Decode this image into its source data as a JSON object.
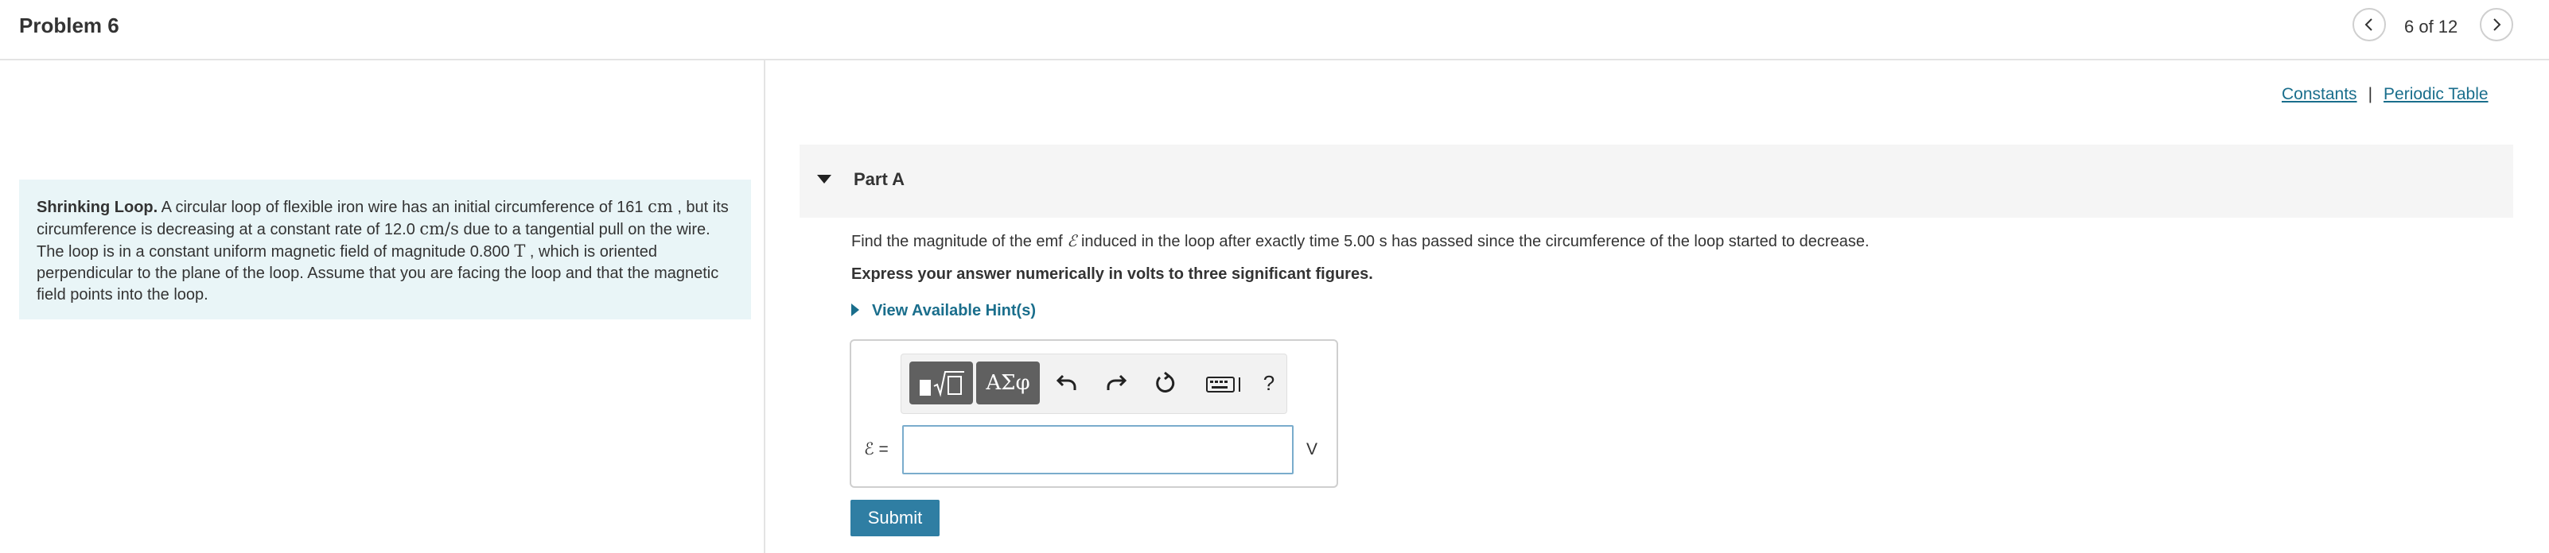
{
  "header": {
    "title": "Problem 6",
    "page_count": "6 of 12"
  },
  "intro": {
    "bold_lead": "Shrinking Loop.",
    "text_1": " A circular loop of flexible iron wire has an initial circumference of 161 ",
    "unit_cm": "cm",
    "text_2": " , but its circumference is decreasing at a constant rate of 12.0 ",
    "unit_cms": "cm/s",
    "text_3": " due to a tangential pull on the wire. The loop is in a constant uniform magnetic field of magnitude 0.800 ",
    "unit_T": "T",
    "text_4": " , which is oriented perpendicular to the plane of the loop. Assume that you are facing the loop and that the magnetic field points into the loop."
  },
  "links": {
    "constants": "Constants",
    "separator": "|",
    "periodic_table": "Periodic Table"
  },
  "part": {
    "label": "Part A",
    "question_1": "Find the magnitude of the emf ",
    "emf_symbol": "ℰ",
    "question_2": " induced in the loop after exactly time 5.00 s has passed since the circumference of the loop started to decrease.",
    "instruction": "Express your answer numerically in volts to three significant figures.",
    "hint": "View Available Hint(s)"
  },
  "answer": {
    "variable_label": "ℰ =",
    "value": "",
    "unit": "V",
    "submit_label": "Submit"
  },
  "toolbar": {
    "greek_label": "ΑΣφ",
    "help_label": "?",
    "icons": [
      "templates-icon",
      "greek-letters-icon",
      "undo-icon",
      "redo-icon",
      "reset-icon",
      "keyboard-icon",
      "help-icon"
    ]
  }
}
